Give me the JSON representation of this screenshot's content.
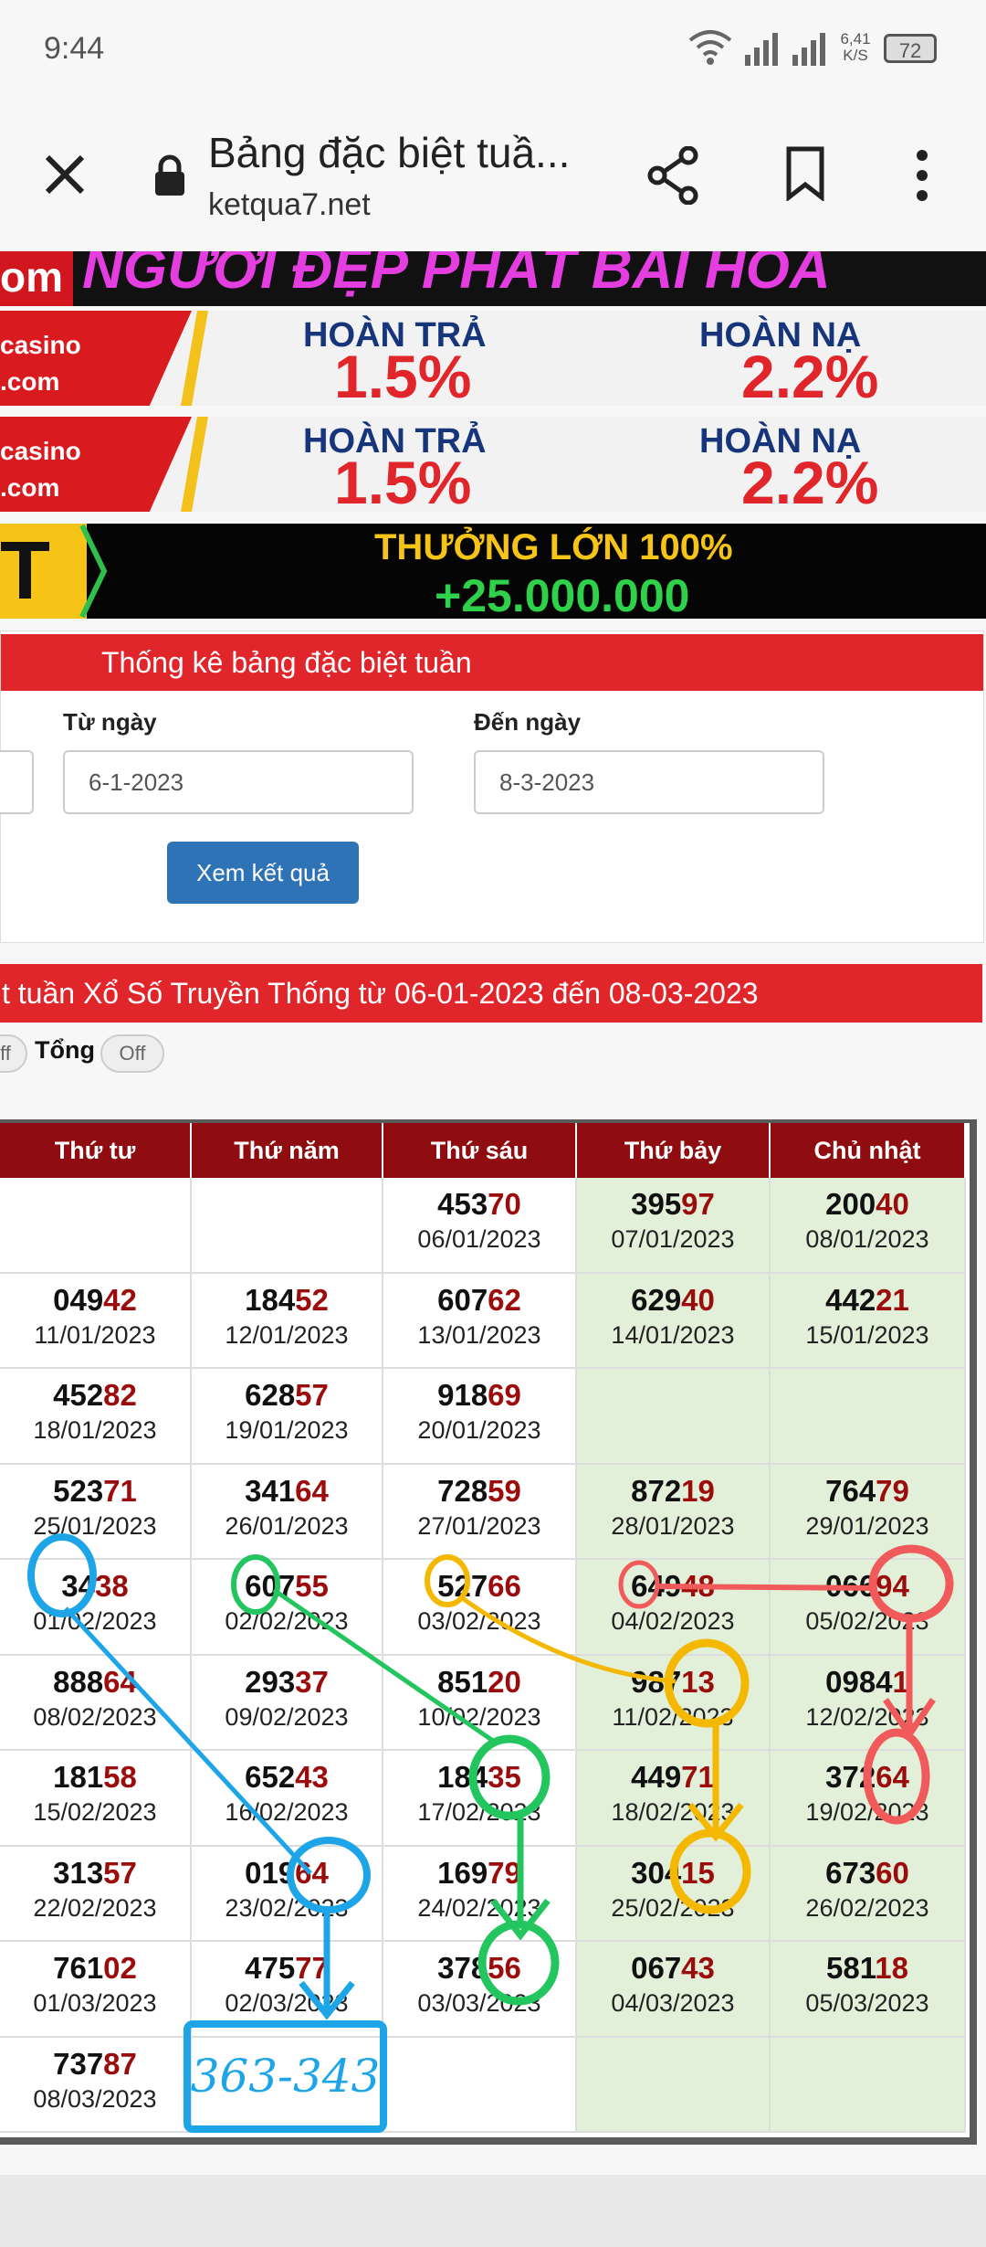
{
  "status_bar": {
    "time": "9:44",
    "speed": "6,41",
    "speed_unit": "K/S",
    "battery": "72"
  },
  "toolbar": {
    "title": "Bảng đặc biệt tuầ...",
    "url": "ketqua7.net"
  },
  "banners": {
    "b1_text": "NGƯỜI ĐẸP PHÁT BÀI HOÀ",
    "b1_left": "om",
    "casino_logo": "casino",
    "casino_com": ".com",
    "hoan_tra_label": "HOÀN TRẢ",
    "hoan_tra_value": "1.5%",
    "hoan_nap_label": "HOÀN NẠ",
    "hoan_nap_value": "2.2%",
    "b4_left": "T",
    "b4_line1": "THƯỞNG LỚN 100%",
    "b4_line2": "+25.000.000"
  },
  "form": {
    "title": "Thống kê bảng đặc biệt tuần",
    "from_label": "Từ ngày",
    "from_value": "6-1-2023",
    "to_label": "Đến ngày",
    "to_value": "8-3-2023",
    "submit": "Xem kết quả"
  },
  "results": {
    "title": "t tuần Xổ Số Truyền Thống từ 06-01-2023 đến 08-03-2023",
    "toggle1_label": "ff",
    "tong_label": "Tổng",
    "tong_toggle": "Off"
  },
  "table": {
    "headers": [
      "Thứ tư",
      "Thứ năm",
      "Thứ sáu",
      "Thứ bảy",
      "Chủ nhật"
    ],
    "rows": [
      [
        {
          "h": "",
          "t": "",
          "d": ""
        },
        {
          "h": "",
          "t": "",
          "d": ""
        },
        {
          "h": "453",
          "t": "70",
          "d": "06/01/2023"
        },
        {
          "h": "395",
          "t": "97",
          "d": "07/01/2023"
        },
        {
          "h": "200",
          "t": "40",
          "d": "08/01/2023"
        }
      ],
      [
        {
          "h": "049",
          "t": "42",
          "d": "11/01/2023"
        },
        {
          "h": "184",
          "t": "52",
          "d": "12/01/2023"
        },
        {
          "h": "607",
          "t": "62",
          "d": "13/01/2023"
        },
        {
          "h": "629",
          "t": "40",
          "d": "14/01/2023"
        },
        {
          "h": "442",
          "t": "21",
          "d": "15/01/2023"
        }
      ],
      [
        {
          "h": "452",
          "t": "82",
          "d": "18/01/2023"
        },
        {
          "h": "628",
          "t": "57",
          "d": "19/01/2023"
        },
        {
          "h": "918",
          "t": "69",
          "d": "20/01/2023"
        },
        {
          "h": "",
          "t": "",
          "d": ""
        },
        {
          "h": "",
          "t": "",
          "d": ""
        }
      ],
      [
        {
          "h": "523",
          "t": "71",
          "d": "25/01/2023"
        },
        {
          "h": "341",
          "t": "64",
          "d": "26/01/2023"
        },
        {
          "h": "728",
          "t": "59",
          "d": "27/01/2023"
        },
        {
          "h": "872",
          "t": "19",
          "d": "28/01/2023"
        },
        {
          "h": "764",
          "t": "79",
          "d": "29/01/2023"
        }
      ],
      [
        {
          "h": "34",
          "t": "38",
          "d": "01/02/2023"
        },
        {
          "h": "607",
          "t": "55",
          "d": "02/02/2023"
        },
        {
          "h": "527",
          "t": "66",
          "d": "03/02/2023"
        },
        {
          "h": "649",
          "t": "48",
          "d": "04/02/2023"
        },
        {
          "h": "066",
          "t": "94",
          "d": "05/02/2023"
        }
      ],
      [
        {
          "h": "888",
          "t": "64",
          "d": "08/02/2023"
        },
        {
          "h": "293",
          "t": "37",
          "d": "09/02/2023"
        },
        {
          "h": "851",
          "t": "20",
          "d": "10/02/2023"
        },
        {
          "h": "987",
          "t": "13",
          "d": "11/02/2023"
        },
        {
          "h": "0984",
          "t": "1",
          "d": "12/02/2023"
        }
      ],
      [
        {
          "h": "181",
          "t": "58",
          "d": "15/02/2023"
        },
        {
          "h": "652",
          "t": "43",
          "d": "16/02/2023"
        },
        {
          "h": "184",
          "t": "35",
          "d": "17/02/2023"
        },
        {
          "h": "449",
          "t": "71",
          "d": "18/02/2023"
        },
        {
          "h": "372",
          "t": "64",
          "d": "19/02/2023"
        }
      ],
      [
        {
          "h": "313",
          "t": "57",
          "d": "22/02/2023"
        },
        {
          "h": "019",
          "t": "64",
          "d": "23/02/2023"
        },
        {
          "h": "169",
          "t": "79",
          "d": "24/02/2023"
        },
        {
          "h": "304",
          "t": "15",
          "d": "25/02/2023"
        },
        {
          "h": "673",
          "t": "60",
          "d": "26/02/2023"
        }
      ],
      [
        {
          "h": "761",
          "t": "02",
          "d": "01/03/2023"
        },
        {
          "h": "475",
          "t": "77",
          "d": "02/03/2023"
        },
        {
          "h": "378",
          "t": "56",
          "d": "03/03/2023"
        },
        {
          "h": "067",
          "t": "43",
          "d": "04/03/2023"
        },
        {
          "h": "581",
          "t": "18",
          "d": "05/03/2023"
        }
      ],
      [
        {
          "h": "737",
          "t": "87",
          "d": "08/03/2023"
        },
        {
          "h": "",
          "t": "",
          "d": ""
        },
        {
          "h": "",
          "t": "",
          "d": ""
        },
        {
          "h": "",
          "t": "",
          "d": ""
        },
        {
          "h": "",
          "t": "",
          "d": ""
        }
      ]
    ]
  },
  "annotation": {
    "handwritten": "363-343"
  },
  "colors": {
    "red_bar": "#e0252b",
    "header": "#8f0c11",
    "weekend": "#e2f0d9",
    "tail": "#9b0d0d",
    "button": "#2f73b7"
  }
}
